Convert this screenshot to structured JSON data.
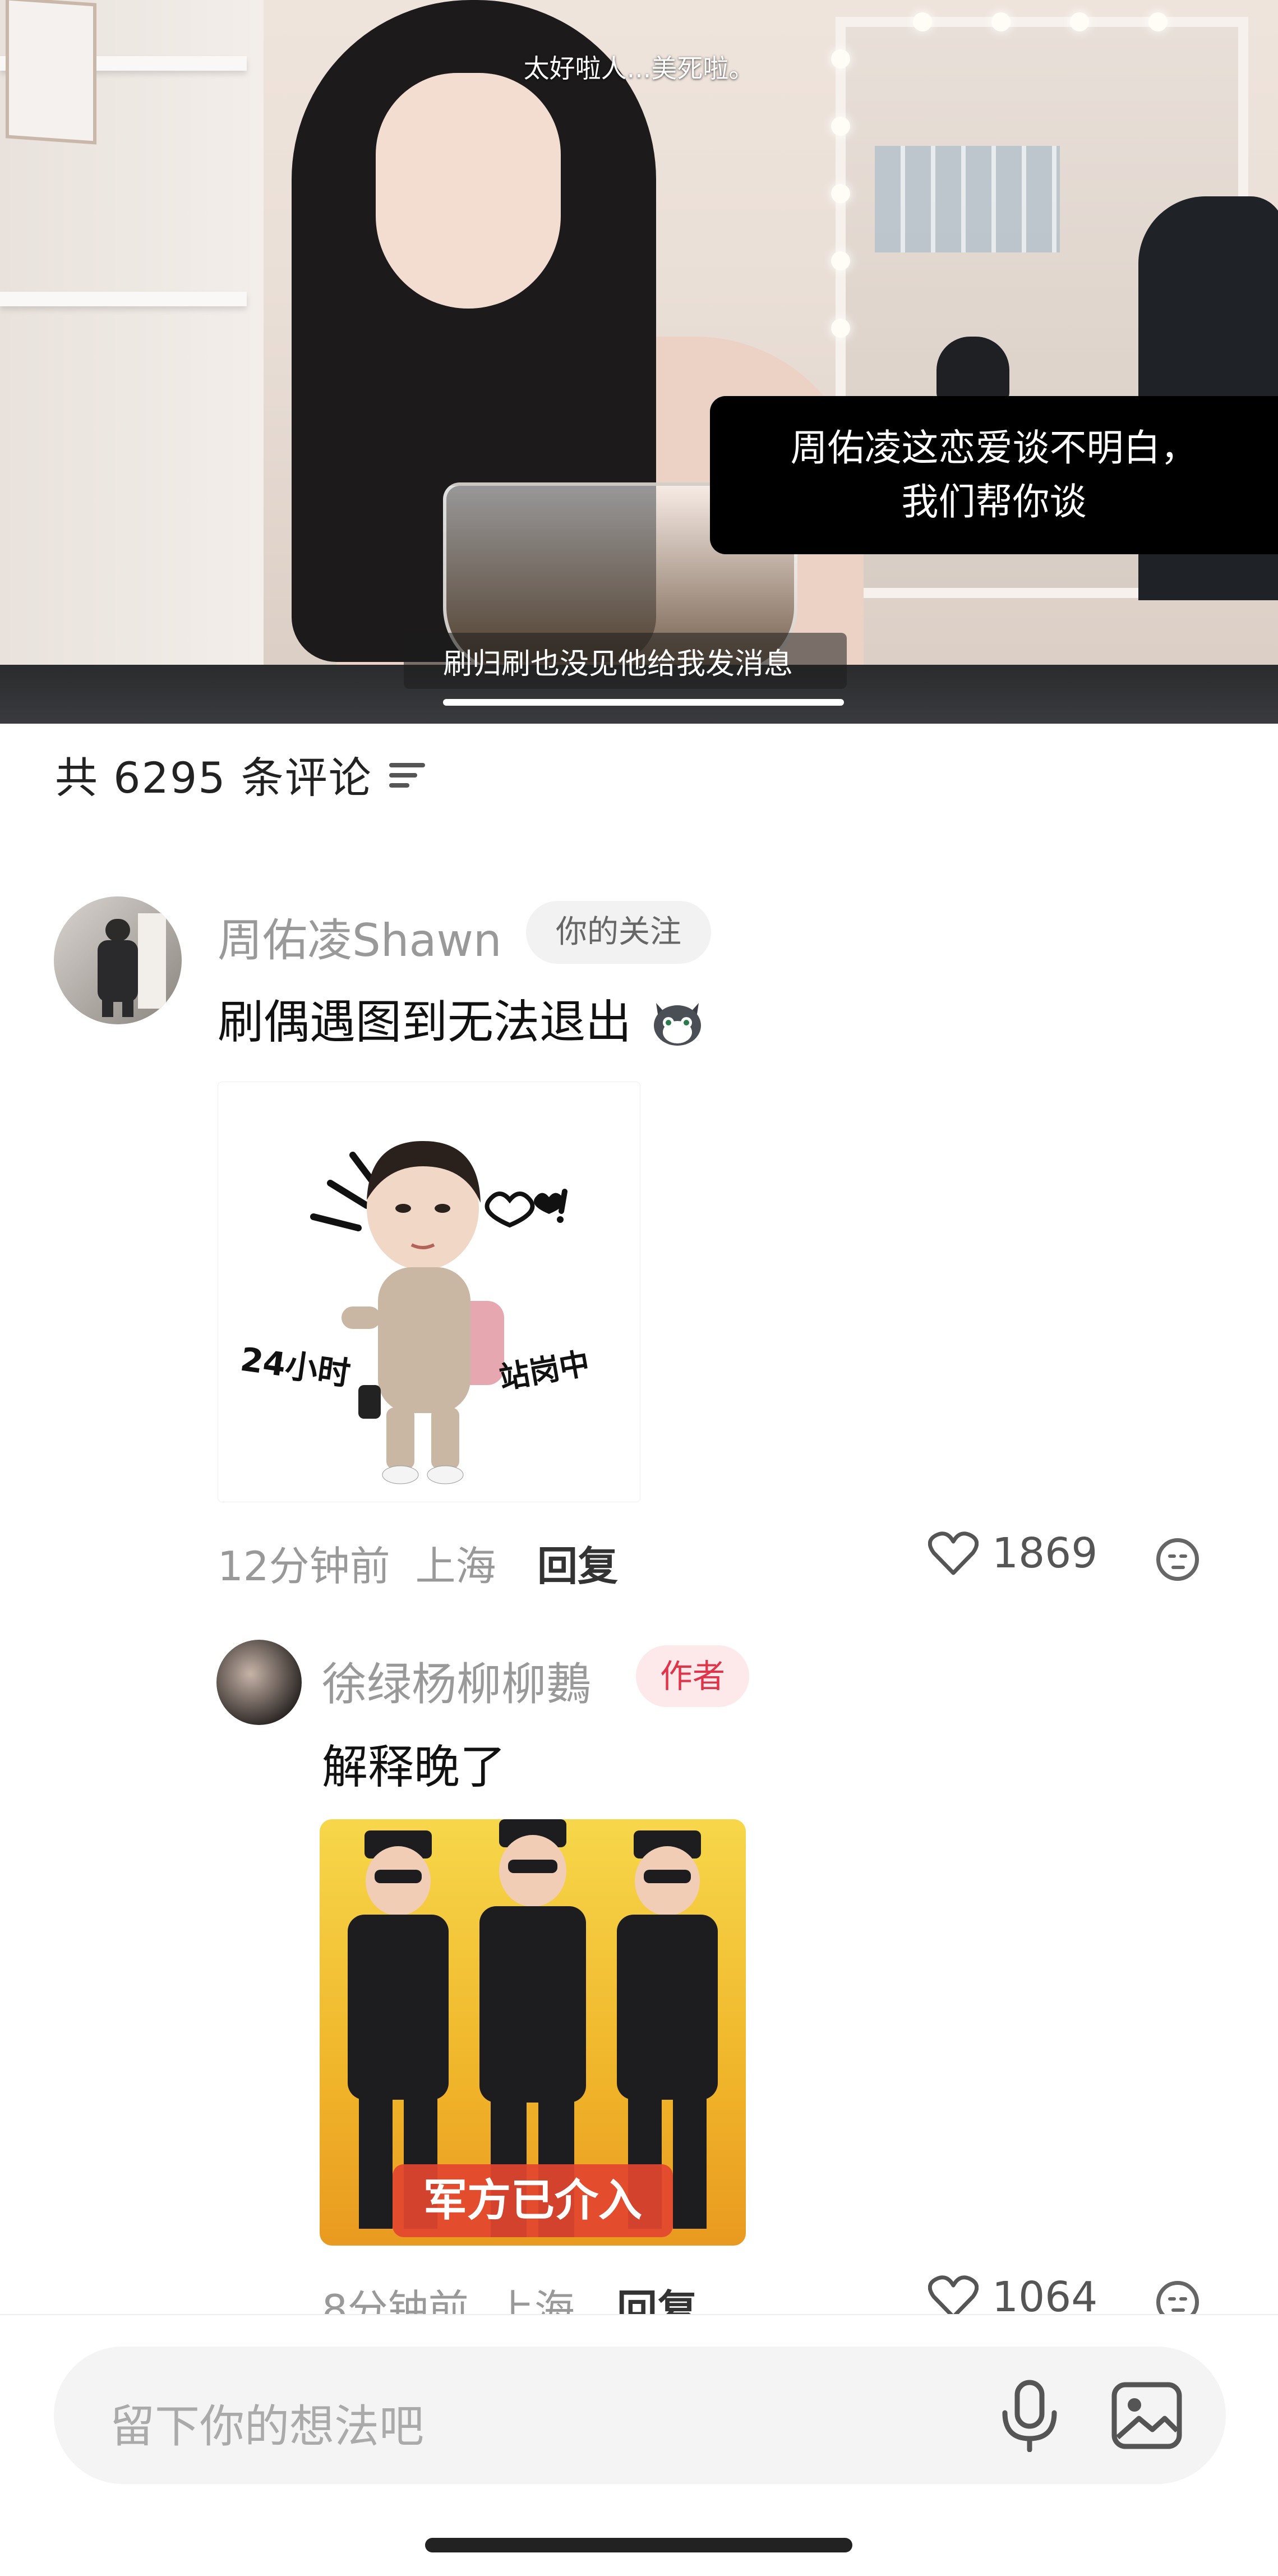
{
  "video": {
    "top_subtitle": "太好啦人...美死啦。",
    "overlay_lines": [
      "周佑凌这恋爱谈不明白，",
      "我们帮你谈"
    ],
    "caption": "刷归刷也没见他给我发消息"
  },
  "comments_header": {
    "count_text": "共 6295 条评论"
  },
  "comments": [
    {
      "username": "周佑凌Shawn",
      "tag": "你的关注",
      "text": "刷偶遇图到无法退出",
      "sticker_texts": [
        "24小时",
        "站岗中"
      ],
      "time": "12分钟前",
      "location": "上海",
      "reply_label": "回复",
      "likes": "1869"
    },
    {
      "username": "徐绿杨柳柳鶈",
      "tag": "作者",
      "text": "解释晚了",
      "sticker_texts": [
        "军方已介入"
      ],
      "time": "8分钟前",
      "location": "上海",
      "reply_label": "回复",
      "likes": "1064"
    }
  ],
  "input": {
    "placeholder": "留下你的想法吧"
  },
  "colors": {
    "author_tag_bg": "#fde8ea",
    "author_tag_text": "#e0344a",
    "follow_tag_bg": "#f2f2f2",
    "follow_tag_text": "#666666",
    "overlay_bg": "#000000"
  },
  "icons": [
    "filter-icon",
    "heart-icon",
    "emoji-icon",
    "microphone-icon",
    "image-icon"
  ]
}
